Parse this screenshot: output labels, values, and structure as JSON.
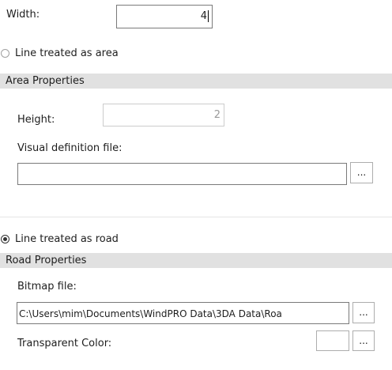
{
  "line_section": {
    "width_label": "Width:",
    "width_value": "4"
  },
  "area_option": {
    "radio_label": "Line treated as area",
    "checked": false
  },
  "area_properties": {
    "header": "Area Properties",
    "height_label": "Height:",
    "height_value": "2",
    "visual_def_label": "Visual definition file:",
    "visual_def_value": "",
    "browse_label": "..."
  },
  "road_option": {
    "radio_label": "Line treated as road",
    "checked": true
  },
  "road_properties": {
    "header": "Road Properties",
    "bitmap_label": "Bitmap file:",
    "bitmap_value": "C:\\Users\\mim\\Documents\\WindPRO Data\\3DA Data\\Roa",
    "bitmap_browse_label": "...",
    "transparent_label": "Transparent Color:",
    "transparent_color": "#ffffff",
    "color_browse_label": "..."
  }
}
